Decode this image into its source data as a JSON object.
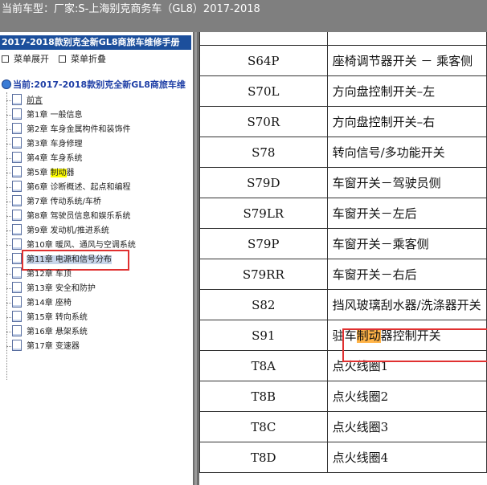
{
  "topbar": {
    "label": "当前车型：",
    "maker": "厂家:S-上海别克商务车（GL8）2017-2018"
  },
  "left": {
    "manual_title": "2017-2018款别克全新GL8商旅车维修手册",
    "expand_label": "菜单展开",
    "collapse_label": "菜单折叠",
    "root_label": "当前:2017-2018款别克全新GL8商旅车维",
    "items": [
      {
        "label": "前言"
      },
      {
        "label": "第1章 一般信息"
      },
      {
        "label": "第2章 车身金属构件和装饰件"
      },
      {
        "label": "第3章 车身修理"
      },
      {
        "label": "第4章 车身系统"
      },
      {
        "label": "第5章 ",
        "highlight": "制动",
        "suffix": "器"
      },
      {
        "label": "第6章 诊断概述、起点和编程"
      },
      {
        "label": "第7章 传动系统/车桥"
      },
      {
        "label": "第8章 驾驶员信息和娱乐系统"
      },
      {
        "label": "第9章 发动机/推进系统"
      },
      {
        "label": "第10章 暖风、通风与空调系统"
      },
      {
        "label": "第11章 电源和信号分布"
      },
      {
        "label": "第12章 车顶"
      },
      {
        "label": "第13章 安全和防护"
      },
      {
        "label": "第14章 座椅"
      },
      {
        "label": "第15章 转向系统"
      },
      {
        "label": "第16章 悬架系统"
      },
      {
        "label": "第17章 变速器"
      }
    ]
  },
  "table": {
    "rows": [
      {
        "code": "",
        "desc": ""
      },
      {
        "code": "S64P",
        "desc": "座椅调节器开关 － 乘客侧"
      },
      {
        "code": "S70L",
        "desc": "方向盘控制开关–左"
      },
      {
        "code": "S70R",
        "desc": "方向盘控制开关–右"
      },
      {
        "code": "S78",
        "desc": "转向信号/多功能开关"
      },
      {
        "code": "S79D",
        "desc": "车窗开关－驾驶员侧"
      },
      {
        "code": "S79LR",
        "desc": "车窗开关－左后"
      },
      {
        "code": "S79P",
        "desc": "车窗开关－乘客侧"
      },
      {
        "code": "S79RR",
        "desc": "车窗开关－右后"
      },
      {
        "code": "S82",
        "desc": "挡风玻璃刮水器/洗涤器开关"
      },
      {
        "code": "S91",
        "desc_pre": "驻车",
        "desc_hl": "制动",
        "desc_post": "器控制开关"
      },
      {
        "code": "T8A",
        "desc": "点火线圈1"
      },
      {
        "code": "T8B",
        "desc": "点火线圈2"
      },
      {
        "code": "T8C",
        "desc": "点火线圈3"
      },
      {
        "code": "T8D",
        "desc": "点火线圈4"
      }
    ]
  },
  "colors": {
    "title_bar": "#7f7f7f",
    "manual_header": "#1c4f9c",
    "highlight_red_box": "#e03030",
    "text_highlight_yellow": "#ffff00",
    "text_highlight_orange": "#ffb347"
  }
}
